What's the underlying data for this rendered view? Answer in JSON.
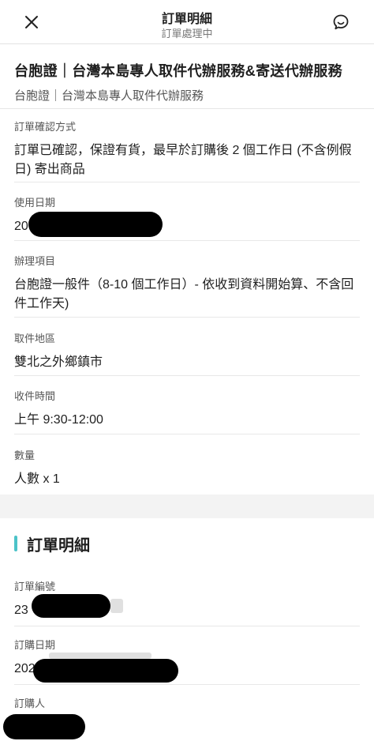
{
  "header": {
    "title": "訂單明細",
    "subtitle": "訂單處理中"
  },
  "product": {
    "name": "台胞證｜台灣本島專人取件代辦服務&寄送代辦服務",
    "plan": "台胞證｜台灣本島專人取件代辦服務"
  },
  "fields": [
    {
      "label": "訂單確認方式",
      "value": "訂單已確認，保證有貨，最早於訂購後 2 個工作日 (不含例假日) 寄出商品"
    },
    {
      "label": "使用日期",
      "value": "20"
    },
    {
      "label": "辦理項目",
      "value": "台胞證一般件（8-10 個工作日）- 依收到資料開始算、不含回件工作天)"
    },
    {
      "label": "取件地區",
      "value": "雙北之外鄉鎮市"
    },
    {
      "label": "收件時間",
      "value": "上午 9:30-12:00"
    },
    {
      "label": "數量",
      "value": "人數 x 1"
    }
  ],
  "details_section": {
    "title": "訂單明細",
    "fields": [
      {
        "label": "訂單編號",
        "value": "23"
      },
      {
        "label": "訂購日期",
        "value": "202"
      },
      {
        "label": "訂購人",
        "value": ""
      }
    ]
  },
  "colors": {
    "accent": "#4cc3c8",
    "redaction": "#000000"
  },
  "icons": {
    "close": "close-icon",
    "chat": "chat-bubble-icon"
  }
}
